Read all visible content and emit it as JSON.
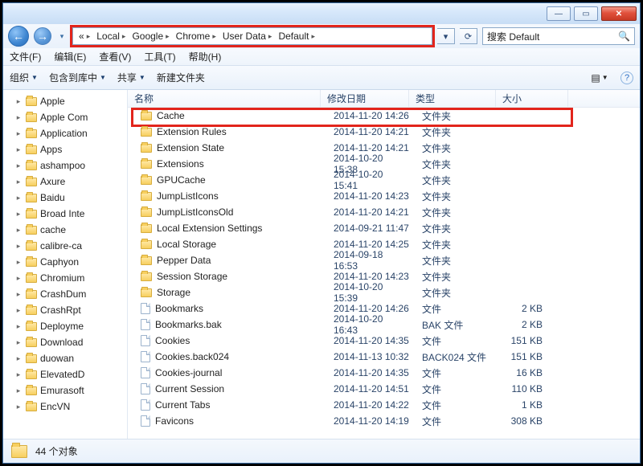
{
  "titlebar": {
    "min": "—",
    "max": "▭",
    "close": "✕"
  },
  "nav": {
    "back": "←",
    "fwd": "→",
    "drop": "▾"
  },
  "breadcrumbs": {
    "lead": "«",
    "items": [
      "Local",
      "Google",
      "Chrome",
      "User Data",
      "Default"
    ]
  },
  "addr_buttons": {
    "refresh": "⟳",
    "dd": "▾"
  },
  "search": {
    "placeholder": "搜索 Default",
    "icon": "🔍"
  },
  "menus": [
    "文件(F)",
    "编辑(E)",
    "查看(V)",
    "工具(T)",
    "帮助(H)"
  ],
  "toolbar": {
    "organize": "组织",
    "include": "包含到库中",
    "share": "共享",
    "newfolder": "新建文件夹",
    "view_icon": "▤",
    "help_icon": "?"
  },
  "tree": [
    {
      "t": "▸",
      "n": "Apple"
    },
    {
      "t": "▸",
      "n": "Apple Com"
    },
    {
      "t": "▸",
      "n": "Application"
    },
    {
      "t": "▸",
      "n": "Apps"
    },
    {
      "t": "▸",
      "n": "ashampoo"
    },
    {
      "t": "▸",
      "n": "Axure"
    },
    {
      "t": "▸",
      "n": "Baidu"
    },
    {
      "t": "▸",
      "n": "Broad Inte"
    },
    {
      "t": "▸",
      "n": "cache"
    },
    {
      "t": "▸",
      "n": "calibre-ca"
    },
    {
      "t": "▸",
      "n": "Caphyon"
    },
    {
      "t": "▸",
      "n": "Chromium"
    },
    {
      "t": "▸",
      "n": "CrashDum"
    },
    {
      "t": "▸",
      "n": "CrashRpt"
    },
    {
      "t": "▸",
      "n": "Deployme"
    },
    {
      "t": "▸",
      "n": "Download"
    },
    {
      "t": "▸",
      "n": "duowan"
    },
    {
      "t": "▸",
      "n": "ElevatedD"
    },
    {
      "t": "▸",
      "n": "Emurasoft"
    },
    {
      "t": "▸",
      "n": "EncVN"
    }
  ],
  "columns": {
    "name": "名称",
    "date": "修改日期",
    "type": "类型",
    "size": "大小"
  },
  "rows": [
    {
      "icon": "folder",
      "name": "Cache",
      "date": "2014-11-20 14:26",
      "type": "文件夹",
      "size": ""
    },
    {
      "icon": "folder",
      "name": "Extension Rules",
      "date": "2014-11-20 14:21",
      "type": "文件夹",
      "size": ""
    },
    {
      "icon": "folder",
      "name": "Extension State",
      "date": "2014-11-20 14:21",
      "type": "文件夹",
      "size": ""
    },
    {
      "icon": "folder",
      "name": "Extensions",
      "date": "2014-10-20 15:38",
      "type": "文件夹",
      "size": ""
    },
    {
      "icon": "folder",
      "name": "GPUCache",
      "date": "2014-10-20 15:41",
      "type": "文件夹",
      "size": ""
    },
    {
      "icon": "folder",
      "name": "JumpListIcons",
      "date": "2014-11-20 14:23",
      "type": "文件夹",
      "size": ""
    },
    {
      "icon": "folder",
      "name": "JumpListIconsOld",
      "date": "2014-11-20 14:21",
      "type": "文件夹",
      "size": ""
    },
    {
      "icon": "folder",
      "name": "Local Extension Settings",
      "date": "2014-09-21 11:47",
      "type": "文件夹",
      "size": ""
    },
    {
      "icon": "folder",
      "name": "Local Storage",
      "date": "2014-11-20 14:25",
      "type": "文件夹",
      "size": ""
    },
    {
      "icon": "folder",
      "name": "Pepper Data",
      "date": "2014-09-18 16:53",
      "type": "文件夹",
      "size": ""
    },
    {
      "icon": "folder",
      "name": "Session Storage",
      "date": "2014-11-20 14:23",
      "type": "文件夹",
      "size": ""
    },
    {
      "icon": "folder",
      "name": "Storage",
      "date": "2014-10-20 15:39",
      "type": "文件夹",
      "size": ""
    },
    {
      "icon": "file",
      "name": "Bookmarks",
      "date": "2014-11-20 14:26",
      "type": "文件",
      "size": "2 KB"
    },
    {
      "icon": "file",
      "name": "Bookmarks.bak",
      "date": "2014-10-20 16:43",
      "type": "BAK 文件",
      "size": "2 KB"
    },
    {
      "icon": "file",
      "name": "Cookies",
      "date": "2014-11-20 14:35",
      "type": "文件",
      "size": "151 KB"
    },
    {
      "icon": "file",
      "name": "Cookies.back024",
      "date": "2014-11-13 10:32",
      "type": "BACK024 文件",
      "size": "151 KB"
    },
    {
      "icon": "file",
      "name": "Cookies-journal",
      "date": "2014-11-20 14:35",
      "type": "文件",
      "size": "16 KB"
    },
    {
      "icon": "file",
      "name": "Current Session",
      "date": "2014-11-20 14:51",
      "type": "文件",
      "size": "110 KB"
    },
    {
      "icon": "file",
      "name": "Current Tabs",
      "date": "2014-11-20 14:22",
      "type": "文件",
      "size": "1 KB"
    },
    {
      "icon": "file",
      "name": "Favicons",
      "date": "2014-11-20 14:19",
      "type": "文件",
      "size": "308 KB"
    }
  ],
  "status": {
    "text": "44 个对象"
  }
}
